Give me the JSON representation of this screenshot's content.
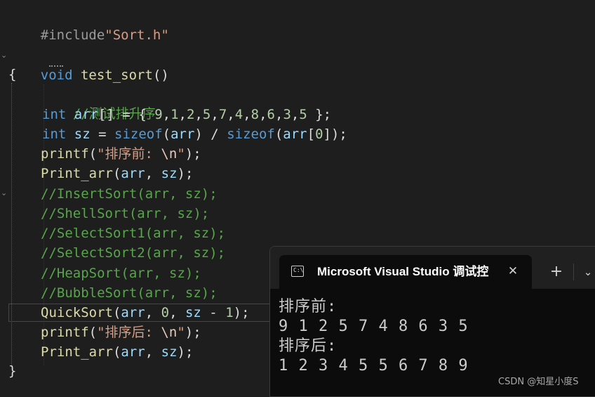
{
  "editor": {
    "lines": [
      {
        "text": "#include\"Sort.h\""
      },
      {
        "text": ""
      },
      {
        "text": "void test_sort()"
      },
      {
        "text": "{"
      },
      {
        "text": "//测试排升序"
      },
      {
        "text": "int arr[] = { 9,1,2,5,7,4,8,6,3,5 };"
      },
      {
        "text": "int sz = sizeof(arr) / sizeof(arr[0]);"
      },
      {
        "text": "printf(\"排序前: \\n\");"
      },
      {
        "text": "Print_arr(arr, sz);"
      },
      {
        "text": "//InsertSort(arr, sz);"
      },
      {
        "text": "//ShellSort(arr, sz);"
      },
      {
        "text": "//SelectSort1(arr, sz);"
      },
      {
        "text": "//SelectSort2(arr, sz);"
      },
      {
        "text": "//HeapSort(arr, sz);"
      },
      {
        "text": "//BubbleSort(arr, sz);"
      },
      {
        "text": "QuickSort(arr, 0, sz - 1);"
      },
      {
        "text": "printf(\"排序后: \\n\");"
      },
      {
        "text": "Print_arr(arr, sz);"
      },
      {
        "text": "}"
      }
    ],
    "colors": {
      "background": "#1e1e1e",
      "keyword": "#569cd6",
      "function": "#dcdcaa",
      "variable": "#9cdcfe",
      "number": "#b5cea8",
      "string": "#d69d85",
      "comment": "#57a64a",
      "preprocessor": "#9b9b9b"
    }
  },
  "console": {
    "title": "Microsoft Visual Studio 调试控制台",
    "tab_icon": "console-app-icon",
    "close_icon": "close-icon",
    "new_tab_icon": "plus-icon",
    "dropdown_icon": "chevron-down-icon",
    "output": [
      "排序前:",
      "9 1 2 5 7 4 8 6 3 5",
      "排序后:",
      "1 2 3 4 5 5 6 7 8 9"
    ]
  },
  "watermark": "CSDN @知星小度S"
}
